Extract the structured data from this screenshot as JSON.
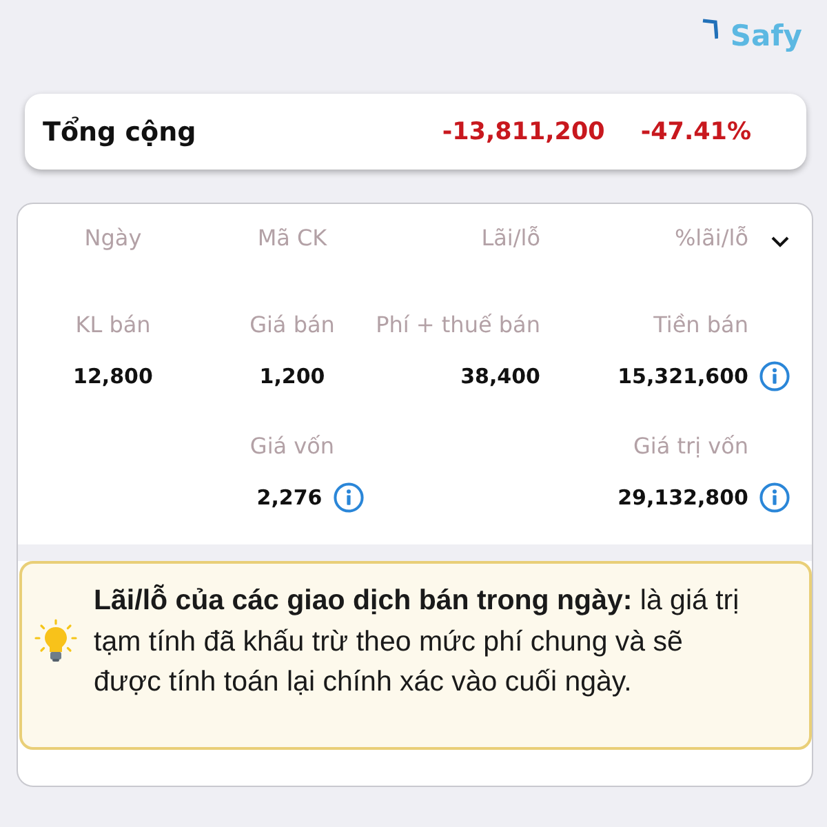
{
  "logo": {
    "text": "Safy"
  },
  "total": {
    "label": "Tổng cộng",
    "amount": "-13,811,200",
    "percent": "-47.41%"
  },
  "table": {
    "columns": [
      "Ngày",
      "Mã CK",
      "Lãi/lỗ",
      "%lãi/lỗ"
    ],
    "rows": [
      {
        "cells": [
          {
            "label": "KL bán",
            "value": "12,800",
            "info": false
          },
          {
            "label": "Giá bán",
            "value": "1,200",
            "info": false
          },
          {
            "label": "Phí + thuế bán",
            "value": "38,400",
            "info": false
          },
          {
            "label": "Tiền bán",
            "value": "15,321,600",
            "info": true
          }
        ]
      },
      {
        "cells": [
          null,
          {
            "label": "Giá vốn",
            "value": "2,276",
            "info": true
          },
          null,
          {
            "label": "Giá trị vốn",
            "value": "29,132,800",
            "info": true
          }
        ]
      }
    ]
  },
  "note": {
    "text": "**Lãi/lỗ của các giao dịch bán trong ngày:** là giá trị tạm tính đã khấu trừ theo mức phí chung và sẽ được tính toán lại chính xác vào cuối ngày."
  }
}
